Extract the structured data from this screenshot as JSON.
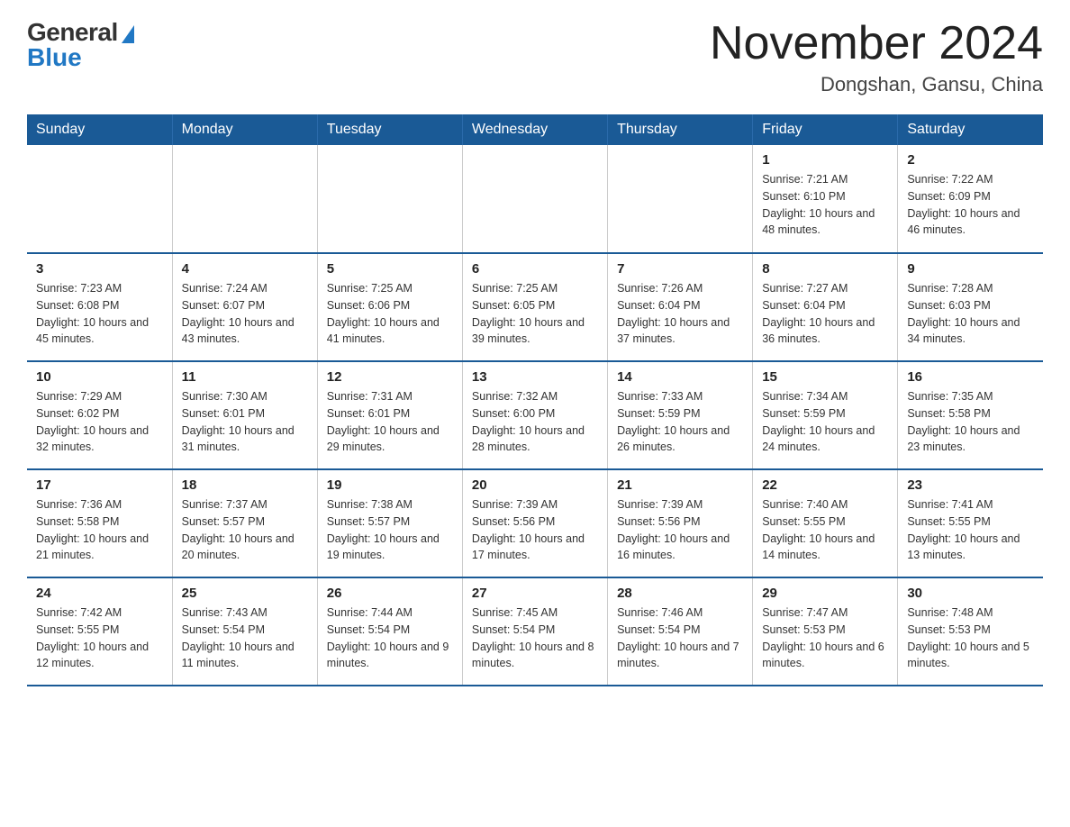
{
  "header": {
    "logo": {
      "general": "General",
      "blue": "Blue"
    },
    "title": "November 2024",
    "location": "Dongshan, Gansu, China"
  },
  "days_of_week": [
    "Sunday",
    "Monday",
    "Tuesday",
    "Wednesday",
    "Thursday",
    "Friday",
    "Saturday"
  ],
  "weeks": [
    [
      {
        "num": "",
        "info": ""
      },
      {
        "num": "",
        "info": ""
      },
      {
        "num": "",
        "info": ""
      },
      {
        "num": "",
        "info": ""
      },
      {
        "num": "",
        "info": ""
      },
      {
        "num": "1",
        "info": "Sunrise: 7:21 AM\nSunset: 6:10 PM\nDaylight: 10 hours and 48 minutes."
      },
      {
        "num": "2",
        "info": "Sunrise: 7:22 AM\nSunset: 6:09 PM\nDaylight: 10 hours and 46 minutes."
      }
    ],
    [
      {
        "num": "3",
        "info": "Sunrise: 7:23 AM\nSunset: 6:08 PM\nDaylight: 10 hours and 45 minutes."
      },
      {
        "num": "4",
        "info": "Sunrise: 7:24 AM\nSunset: 6:07 PM\nDaylight: 10 hours and 43 minutes."
      },
      {
        "num": "5",
        "info": "Sunrise: 7:25 AM\nSunset: 6:06 PM\nDaylight: 10 hours and 41 minutes."
      },
      {
        "num": "6",
        "info": "Sunrise: 7:25 AM\nSunset: 6:05 PM\nDaylight: 10 hours and 39 minutes."
      },
      {
        "num": "7",
        "info": "Sunrise: 7:26 AM\nSunset: 6:04 PM\nDaylight: 10 hours and 37 minutes."
      },
      {
        "num": "8",
        "info": "Sunrise: 7:27 AM\nSunset: 6:04 PM\nDaylight: 10 hours and 36 minutes."
      },
      {
        "num": "9",
        "info": "Sunrise: 7:28 AM\nSunset: 6:03 PM\nDaylight: 10 hours and 34 minutes."
      }
    ],
    [
      {
        "num": "10",
        "info": "Sunrise: 7:29 AM\nSunset: 6:02 PM\nDaylight: 10 hours and 32 minutes."
      },
      {
        "num": "11",
        "info": "Sunrise: 7:30 AM\nSunset: 6:01 PM\nDaylight: 10 hours and 31 minutes."
      },
      {
        "num": "12",
        "info": "Sunrise: 7:31 AM\nSunset: 6:01 PM\nDaylight: 10 hours and 29 minutes."
      },
      {
        "num": "13",
        "info": "Sunrise: 7:32 AM\nSunset: 6:00 PM\nDaylight: 10 hours and 28 minutes."
      },
      {
        "num": "14",
        "info": "Sunrise: 7:33 AM\nSunset: 5:59 PM\nDaylight: 10 hours and 26 minutes."
      },
      {
        "num": "15",
        "info": "Sunrise: 7:34 AM\nSunset: 5:59 PM\nDaylight: 10 hours and 24 minutes."
      },
      {
        "num": "16",
        "info": "Sunrise: 7:35 AM\nSunset: 5:58 PM\nDaylight: 10 hours and 23 minutes."
      }
    ],
    [
      {
        "num": "17",
        "info": "Sunrise: 7:36 AM\nSunset: 5:58 PM\nDaylight: 10 hours and 21 minutes."
      },
      {
        "num": "18",
        "info": "Sunrise: 7:37 AM\nSunset: 5:57 PM\nDaylight: 10 hours and 20 minutes."
      },
      {
        "num": "19",
        "info": "Sunrise: 7:38 AM\nSunset: 5:57 PM\nDaylight: 10 hours and 19 minutes."
      },
      {
        "num": "20",
        "info": "Sunrise: 7:39 AM\nSunset: 5:56 PM\nDaylight: 10 hours and 17 minutes."
      },
      {
        "num": "21",
        "info": "Sunrise: 7:39 AM\nSunset: 5:56 PM\nDaylight: 10 hours and 16 minutes."
      },
      {
        "num": "22",
        "info": "Sunrise: 7:40 AM\nSunset: 5:55 PM\nDaylight: 10 hours and 14 minutes."
      },
      {
        "num": "23",
        "info": "Sunrise: 7:41 AM\nSunset: 5:55 PM\nDaylight: 10 hours and 13 minutes."
      }
    ],
    [
      {
        "num": "24",
        "info": "Sunrise: 7:42 AM\nSunset: 5:55 PM\nDaylight: 10 hours and 12 minutes."
      },
      {
        "num": "25",
        "info": "Sunrise: 7:43 AM\nSunset: 5:54 PM\nDaylight: 10 hours and 11 minutes."
      },
      {
        "num": "26",
        "info": "Sunrise: 7:44 AM\nSunset: 5:54 PM\nDaylight: 10 hours and 9 minutes."
      },
      {
        "num": "27",
        "info": "Sunrise: 7:45 AM\nSunset: 5:54 PM\nDaylight: 10 hours and 8 minutes."
      },
      {
        "num": "28",
        "info": "Sunrise: 7:46 AM\nSunset: 5:54 PM\nDaylight: 10 hours and 7 minutes."
      },
      {
        "num": "29",
        "info": "Sunrise: 7:47 AM\nSunset: 5:53 PM\nDaylight: 10 hours and 6 minutes."
      },
      {
        "num": "30",
        "info": "Sunrise: 7:48 AM\nSunset: 5:53 PM\nDaylight: 10 hours and 5 minutes."
      }
    ]
  ]
}
